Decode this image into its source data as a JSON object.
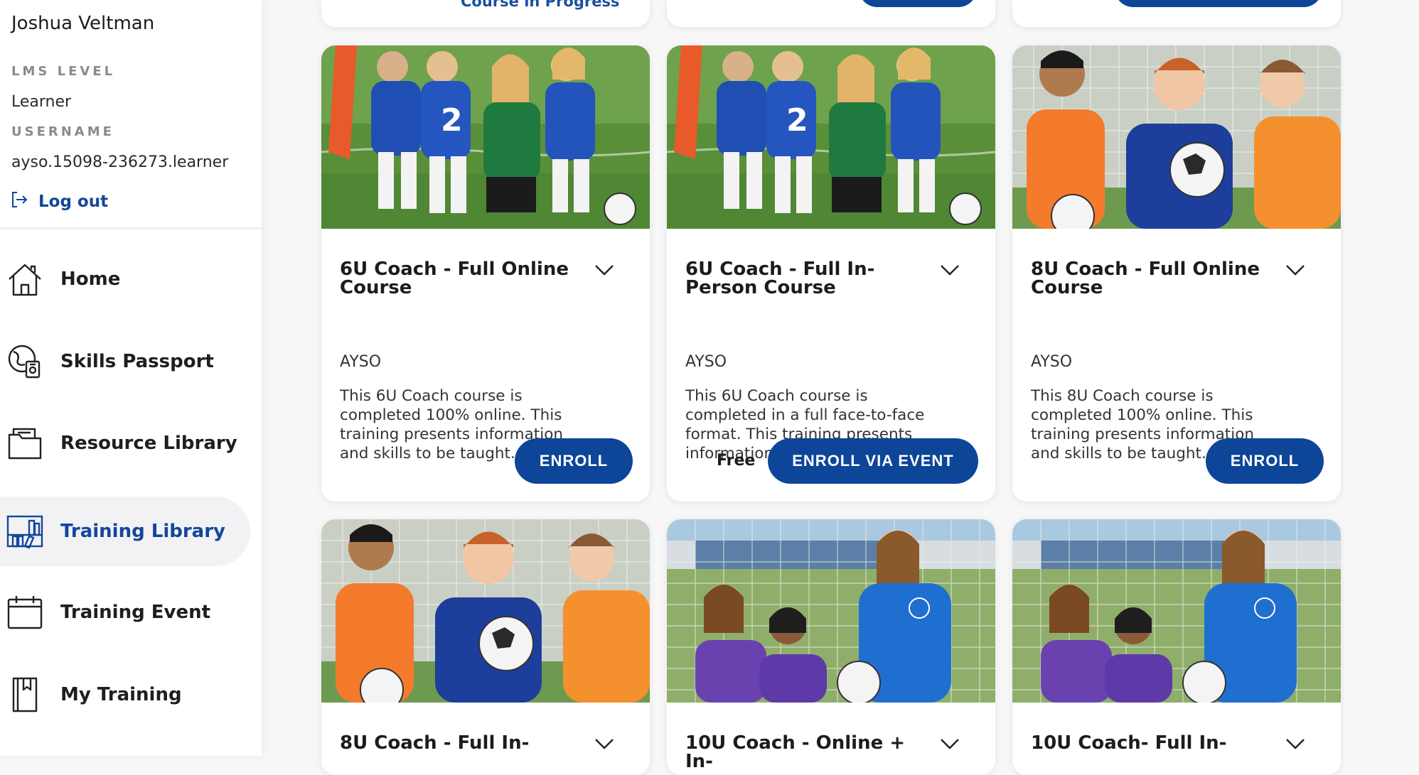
{
  "profile": {
    "name": "Joshua Veltman",
    "lms_level_label": "LMS LEVEL",
    "lms_level_value": "Learner",
    "username_label": "USERNAME",
    "username_value": "ayso.15098-236273.learner",
    "logout_label": "Log out"
  },
  "nav": {
    "items": [
      {
        "label": "Home",
        "icon": "home-icon"
      },
      {
        "label": "Skills Passport",
        "icon": "skills-passport-icon"
      },
      {
        "label": "Resource Library",
        "icon": "folder-icon"
      },
      {
        "label": "Training Library",
        "icon": "library-icon",
        "active": true
      },
      {
        "label": "Training Event",
        "icon": "calendar-icon"
      },
      {
        "label": "My Training",
        "icon": "book-icon"
      }
    ]
  },
  "top_row": {
    "card1_link": "Course in Progress"
  },
  "courses": [
    {
      "title": "6U Coach - Full Online Course",
      "org": "AYSO",
      "description": "This 6U Coach course is completed 100% online. This training presents information and skills to be taught...",
      "button": "ENROLL"
    },
    {
      "title": "6U Coach - Full In-Person Course",
      "org": "AYSO",
      "description": "This 6U Coach course is completed in a full face-to-face format. This training presents information and...",
      "price": "Free",
      "button": "ENROLL VIA EVENT"
    },
    {
      "title": "8U Coach - Full Online Course",
      "org": "AYSO",
      "description": "This 8U Coach course is completed 100% online. This training presents information and skills to be taught...",
      "button": "ENROLL"
    },
    {
      "title": "8U Coach - Full In-"
    },
    {
      "title": "10U Coach - Online + In-"
    },
    {
      "title": "10U Coach- Full In-"
    }
  ],
  "colors": {
    "brand_blue": "#0d4598",
    "link_blue": "#13469b",
    "active_nav_bg": "#f2f2f4"
  }
}
